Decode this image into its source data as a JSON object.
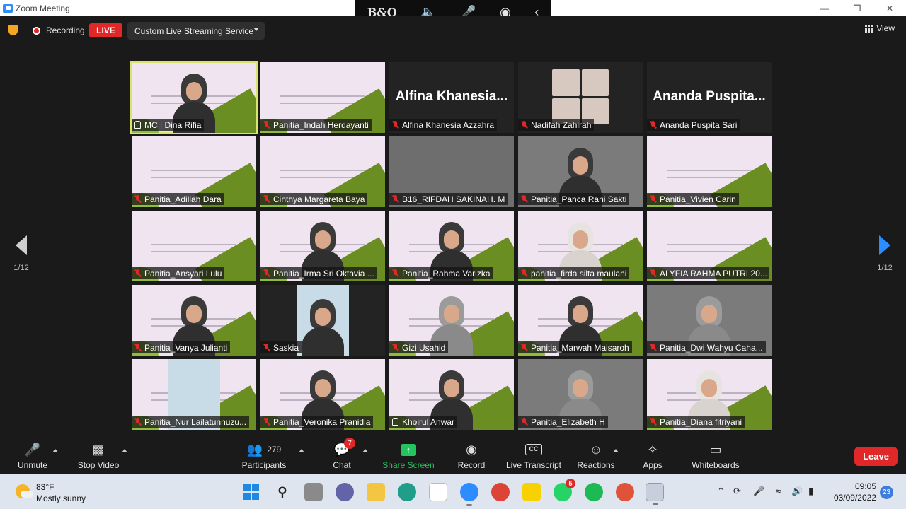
{
  "window": {
    "title": "Zoom Meeting"
  },
  "float_bar": {
    "brand": "B&O"
  },
  "top_bar": {
    "recording_label": "Recording",
    "live_label": "LIVE",
    "stream_service": "Custom Live Streaming Service",
    "view_label": "View"
  },
  "pagination": {
    "left": "1/12",
    "right": "1/12"
  },
  "tiles": [
    {
      "name": "MC | Dina Rifia",
      "type": "speaker",
      "muted": false
    },
    {
      "name": "Panitia_Indah Herdayanti",
      "type": "slide",
      "muted": true
    },
    {
      "name": "Alfina Khanesia Azzahra",
      "type": "name",
      "display": "Alfina  Khanesia...",
      "muted": true
    },
    {
      "name": "Nadifah Zahirah",
      "type": "collage",
      "muted": true
    },
    {
      "name": "Ananda Puspita Sari",
      "type": "name",
      "display": "Ananda  Puspita...",
      "muted": true
    },
    {
      "name": "Panitia_Adillah Dara",
      "type": "slide",
      "muted": true
    },
    {
      "name": "Cinthya Margareta Baya",
      "type": "slide",
      "muted": true
    },
    {
      "name": "B16_RIFDAH SAKINAH. M",
      "type": "grey",
      "muted": true
    },
    {
      "name": "Panitia_Panca Rani Sakti",
      "type": "camera",
      "muted": true
    },
    {
      "name": "Panitia_Vivien Carin",
      "type": "slide",
      "muted": true
    },
    {
      "name": "Panitia_Ansyari Lulu",
      "type": "slide",
      "muted": true
    },
    {
      "name": "Panitia_Irma Sri Oktavia ...",
      "type": "slide-person",
      "muted": true
    },
    {
      "name": "Panitia_Rahma Varizka",
      "type": "slide-person",
      "muted": true
    },
    {
      "name": "panitia_firda silta maulani",
      "type": "slide-person-light",
      "muted": true
    },
    {
      "name": "ALYFIA RAHMA PUTRI 20...",
      "type": "slide",
      "muted": true
    },
    {
      "name": "Panitia_Vanya Julianti",
      "type": "slide-person",
      "muted": true
    },
    {
      "name": "Saskia",
      "type": "portrait",
      "muted": true
    },
    {
      "name": "Gizi Usahid",
      "type": "slide-person-grey",
      "muted": true
    },
    {
      "name": "Panitia_Marwah Maisaroh",
      "type": "slide-person",
      "muted": true
    },
    {
      "name": "Panitia_Dwi Wahyu Caha...",
      "type": "camera-grey",
      "muted": true
    },
    {
      "name": "Panitia_Nur Lailatunnuzu...",
      "type": "portrait-slide",
      "muted": true
    },
    {
      "name": "Panitia_Veronika Pranidia",
      "type": "slide-person",
      "muted": true
    },
    {
      "name": "Khoirul Anwar",
      "type": "slide-person",
      "muted": false
    },
    {
      "name": "Panitia_Elizabeth H",
      "type": "camera-grey",
      "muted": true
    },
    {
      "name": "Panitia_Diana fitriyani",
      "type": "slide-person-light",
      "muted": true
    }
  ],
  "toolbar": {
    "unmute": "Unmute",
    "stop_video": "Stop Video",
    "participants_count": "279",
    "participants": "Participants",
    "chat": "Chat",
    "chat_badge": "7",
    "share_screen": "Share Screen",
    "record": "Record",
    "live_transcript": "Live Transcript",
    "cc": "CC",
    "reactions": "Reactions",
    "apps": "Apps",
    "whiteboards": "Whiteboards",
    "leave": "Leave"
  },
  "taskbar": {
    "temperature": "83°F",
    "weather": "Mostly sunny",
    "whatsapp_badge": "5",
    "time": "09:05",
    "date": "03/09/2022",
    "notifications": "23"
  },
  "colors": {
    "accent": "#2d8cff",
    "danger": "#e02828",
    "share": "#22c55e",
    "active_speaker": "#d8e56a"
  }
}
